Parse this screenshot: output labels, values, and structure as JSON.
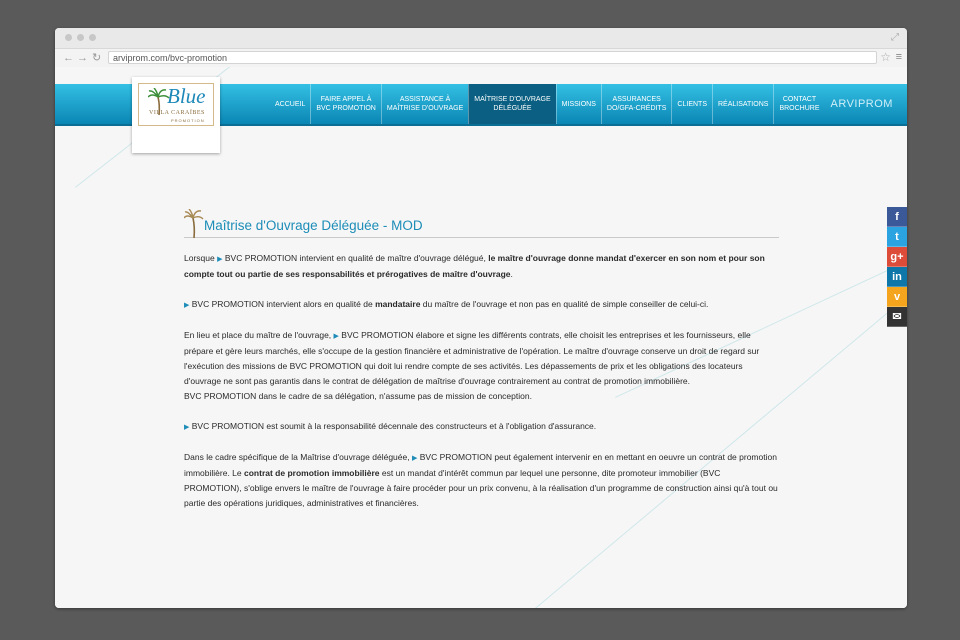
{
  "browser": {
    "url": "arviprom.com/bvc-promotion"
  },
  "logo": {
    "word": "Blue",
    "line": "VILLA CARAÏBES",
    "sub": "PROMOTION"
  },
  "nav": {
    "items": [
      {
        "l1": "ACCUEIL",
        "l2": ""
      },
      {
        "l1": "FAIRE APPEL À",
        "l2": "BVC PROMOTION"
      },
      {
        "l1": "ASSISTANCE À",
        "l2": "MAÎTRISE D'OUVRAGE"
      },
      {
        "l1": "MAÎTRISE D'OUVRAGE",
        "l2": "DÉLÉGUÉE"
      },
      {
        "l1": "MISSIONS",
        "l2": ""
      },
      {
        "l1": "ASSURANCES",
        "l2": "DO/GFA-CRÉDITS"
      },
      {
        "l1": "CLIENTS",
        "l2": ""
      },
      {
        "l1": "RÉALISATIONS",
        "l2": ""
      },
      {
        "l1": "CONTACT",
        "l2": "BROCHURE"
      }
    ],
    "active_index": 3,
    "brand": "ARVIPROM"
  },
  "social": {
    "facebook": "f",
    "twitter": "t",
    "google": "g+",
    "linkedin": "in",
    "viadeo": "v",
    "email": "✉",
    "colors": {
      "facebook": "#3b5998",
      "twitter": "#2ba3e1",
      "google": "#dd4b39",
      "linkedin": "#0e76a8",
      "viadeo": "#f4a41d",
      "email": "#333333"
    }
  },
  "content": {
    "title": "Maîtrise d'Ouvrage Déléguée - MOD",
    "brand": "BVC PROMOTION",
    "p1": {
      "a": "Lorsque ",
      "b": " intervient en qualité de maître d'ouvrage délégué, ",
      "c": "le maître d'ouvrage donne mandat d'exercer en son nom et pour son compte tout ou partie de ses responsabilités et prérogatives de maître d'ouvrage",
      "d": "."
    },
    "p2": {
      "a": " intervient alors en qualité de ",
      "b": "mandataire",
      "c": " du maître de l'ouvrage et non pas en qualité de simple conseiller de celui-ci."
    },
    "p3": {
      "a": "En lieu et place du maître de l'ouvrage, ",
      "b": " élabore et signe les différents contrats, elle choisit les entreprises et les fournisseurs, elle prépare et gère leurs marchés, elle s'occupe de la gestion financière et administrative de l'opération. Le maître d'ouvrage conserve un droit de regard sur l'exécution des missions de BVC PROMOTION qui doit lui rendre compte de ses activités. Les dépassements de prix et les obligations des locateurs d'ouvrage ne sont pas garantis dans le contrat de délégation de maîtrise d'ouvrage contrairement au contrat de promotion immobilière.",
      "c": "BVC PROMOTION dans le cadre de sa délégation, n'assume pas de mission de conception."
    },
    "p4": {
      "a": " est soumit à la responsabilité décennale des constructeurs et à l'obligation d'assurance."
    },
    "p5": {
      "a": "Dans le cadre spécifique de la Maîtrise d'ouvrage déléguée, ",
      "b": " peut également intervenir en en mettant en oeuvre un contrat de promotion immobilière. Le ",
      "c": "contrat de promotion immobilière",
      "d": " est un mandat d'intérêt commun par lequel une personne, dite promoteur immobilier (BVC PROMOTION), s'oblige envers le maître de l'ouvrage à faire procéder pour un prix convenu, à la réalisation d'un programme de construction ainsi qu'à tout ou partie des opérations juridiques, administratives et financières."
    }
  }
}
